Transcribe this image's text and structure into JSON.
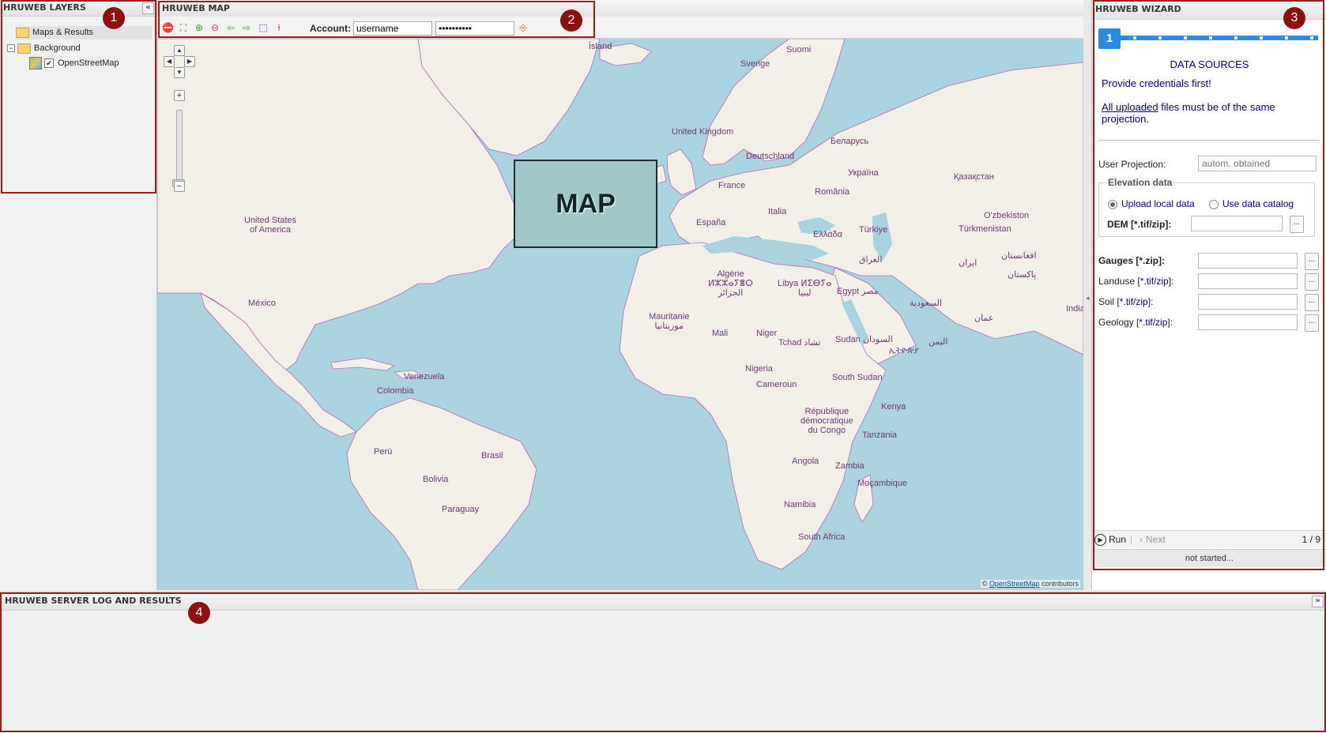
{
  "layers": {
    "title": "HRUWEB LAYERS",
    "collapse_icon": "double-chevron-left",
    "tree": {
      "maps_results": "Maps & Results",
      "background": "Background",
      "background_toggle": "−",
      "osm": "OpenStreetMap",
      "osm_checked": true
    }
  },
  "map": {
    "title": "HRUWEB MAP",
    "toolbar": {
      "account_label": "Account:",
      "username": "username",
      "password": "••••••••••",
      "icons": [
        "stop-icon",
        "zoom-extent-icon",
        "zoom-in-icon",
        "zoom-out-icon",
        "back-arrow-icon",
        "forward-arrow-icon",
        "zoom-box-icon",
        "info-pin-icon",
        "login-icon"
      ]
    },
    "overlay_label": "MAP",
    "attribution": {
      "prefix": "©",
      "link": "OpenStreetMap",
      "suffix": "contributors"
    },
    "labels": {
      "island": "Ísland",
      "suomi": "Suomi",
      "sverige": "Sverige",
      "uk": "United Kingdom",
      "belarus": "Беларусь",
      "deutschland": "Deutschland",
      "ukraina": "Україна",
      "kazakhstan": "Қазақстан",
      "france": "France",
      "romania": "România",
      "usa": "United States\nof America",
      "uzbekiston": "O'zbekiston",
      "italia": "Italia",
      "espana": "España",
      "turkiye": "Türkiye",
      "turkmenistan": "Türkmenistan",
      "ellada": "Ελλάδα",
      "iraq": "العراق",
      "iran": "ایران",
      "afghanistan": "افغانستان",
      "pakistan": "پاکستان",
      "algerie": "Algérie\nⵍⵣⵣⴰⵢⴻⵔ\nالجزائر",
      "libya": "Libya ⵍⵉⴱⵢⴰ\nليبيا",
      "egypt": "Egypt مصر",
      "mexico": "México",
      "saudi": "السعودية",
      "oman": "عمان",
      "india": "India",
      "mauritanie": "Mauritanie\nموريتانيا",
      "mali": "Mali",
      "niger": "Niger",
      "tchad": "Tchad تشاد",
      "sudan": "Sudan السودان",
      "yemen": "اليمن",
      "ethiopia": "ኢትዮጵያ",
      "venezuela": "Venezuela",
      "nigeria": "Nigeria",
      "colombia": "Colombia",
      "cameroun": "Cameroun",
      "south_sudan": "South Sudan",
      "kenya": "Kenya",
      "rdc": "République\ndémocratique\ndu Congo",
      "tanzania": "Tanzania",
      "peru": "Perú",
      "brasil": "Brasil",
      "angola": "Angola",
      "zambia": "Zambia",
      "bolivia": "Bolivia",
      "mocambique": "Moçambique",
      "paraguay": "Paraguay",
      "namibia": "Namibia",
      "south_africa": "South Africa"
    }
  },
  "wizard": {
    "title": "HRUWEB WIZARD",
    "current_step": "1",
    "heading": "DATA SOURCES",
    "credentials_msg": "Provide credentials first!",
    "uploaded_link": "All uploaded",
    "uploaded_rest": " files must be of the same projection.",
    "user_projection_label": "User Projection:",
    "user_projection_placeholder": "autom. obtained",
    "elevation_legend": "Elevation data",
    "radio_upload": "Upload local data",
    "radio_catalog": "Use data catalog",
    "dem_label": "DEM [*.tif/zip]:",
    "gauges_label": "Gauges [*.zip]:",
    "landuse_label_a": "Landuse [",
    "landuse_label_b": "*.tif/zip",
    "landuse_label_c": "]:",
    "soil_label_a": "Soil [",
    "soil_label_b": "*.tif/zip",
    "soil_label_c": "]:",
    "geology_label_a": "Geology [",
    "geology_label_b": "*.tif/zip",
    "geology_label_c": "]:",
    "browse_label": "...",
    "run_label": "Run",
    "next_label": "Next",
    "page_indicator": "1 / 9",
    "status": "not started..."
  },
  "log": {
    "title": "HRUWEB SERVER LOG AND RESULTS",
    "expand_icon": "double-chevron-down"
  },
  "annotations": [
    "1",
    "2",
    "3",
    "4"
  ],
  "colors": {
    "annotation": "#8b1010",
    "wizard_text": "#000080",
    "step_bar": "#2b8be0",
    "ocean": "#aad3df",
    "land": "#f2efe9",
    "border": "#b06cb5"
  }
}
